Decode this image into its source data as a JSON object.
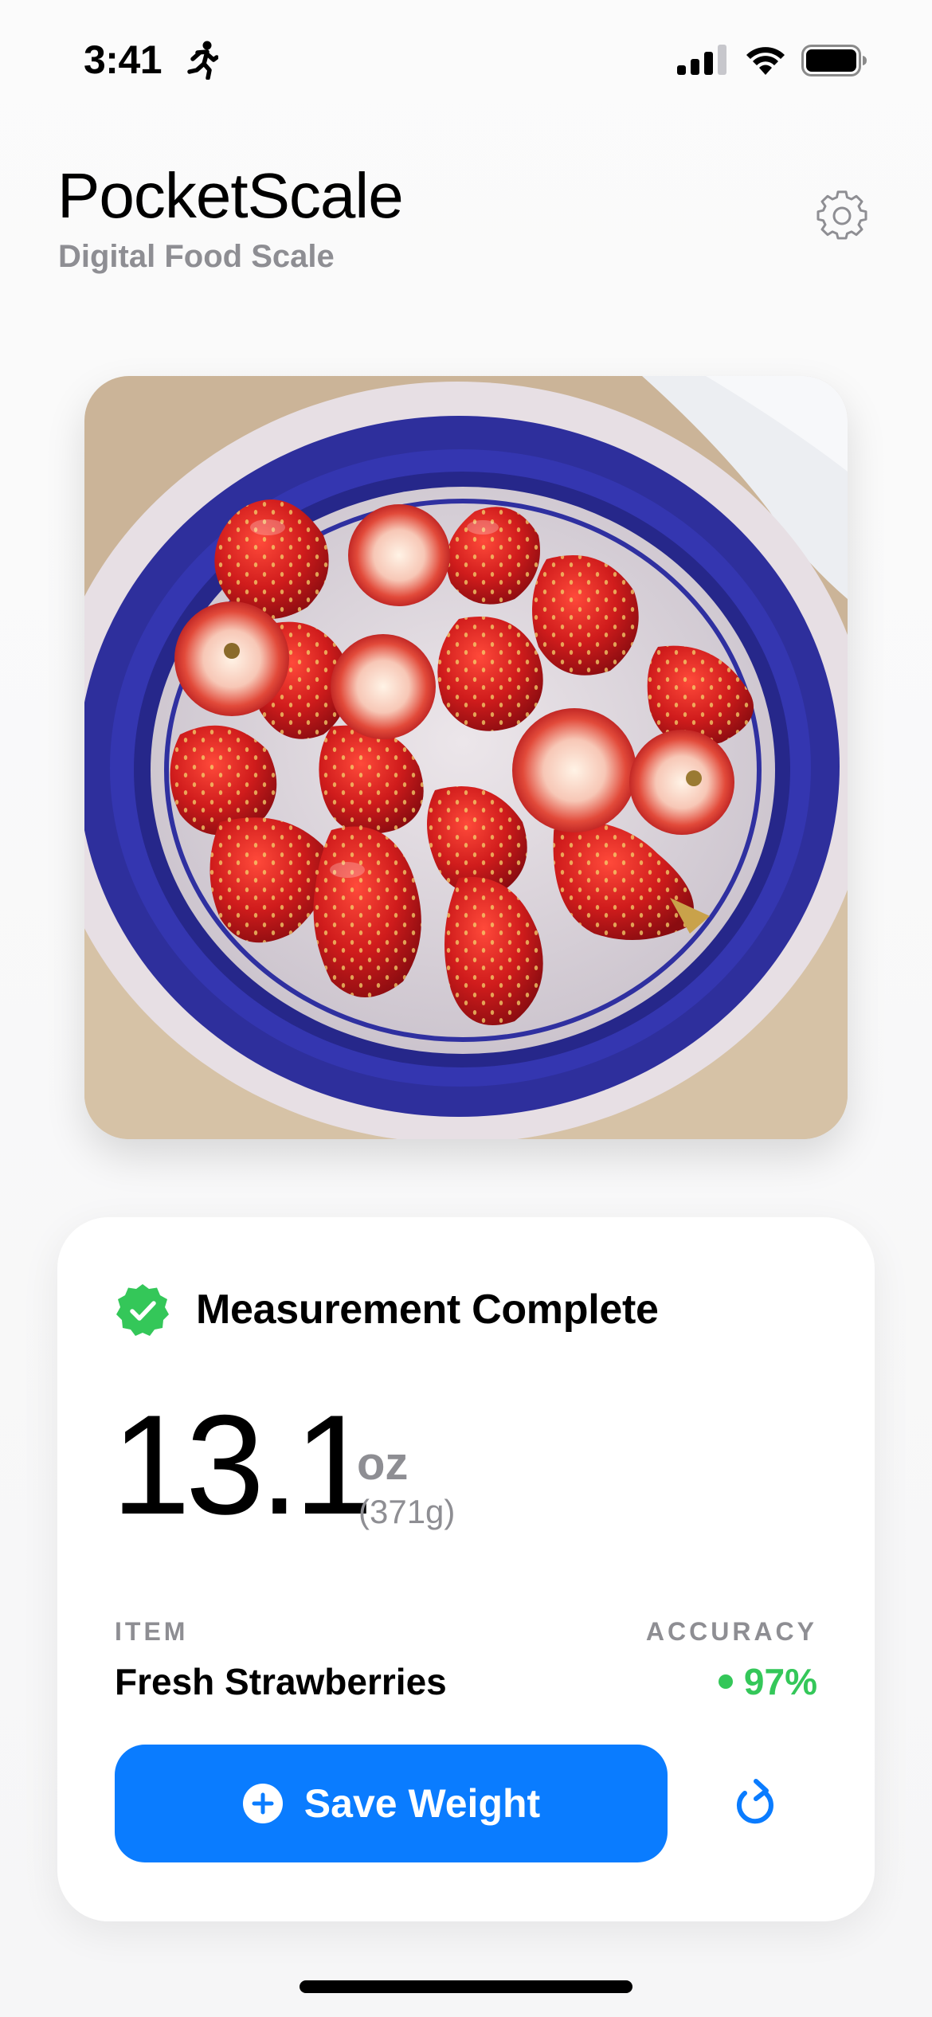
{
  "status_bar": {
    "time": "3:41",
    "activity_icon": "running-figure-icon",
    "signal_icon": "cellular-signal-icon",
    "wifi_icon": "wifi-icon",
    "battery_icon": "battery-full-icon"
  },
  "header": {
    "title": "PocketScale",
    "subtitle": "Digital Food Scale",
    "settings_icon": "gear-icon"
  },
  "photo": {
    "subject": "bowl-of-strawberries"
  },
  "result": {
    "status_icon": "verified-check-badge-icon",
    "status_text": "Measurement Complete",
    "weight_value": "13.1",
    "weight_unit": "oz",
    "weight_grams": "(371g)",
    "item_label": "ITEM",
    "item_value": "Fresh Strawberries",
    "accuracy_label": "ACCURACY",
    "accuracy_value": "97%",
    "save_button_label": "Save Weight",
    "save_icon": "plus-circle-icon",
    "refresh_icon": "refresh-icon"
  },
  "colors": {
    "accent": "#0a7cff",
    "success": "#34c759",
    "secondary_text": "#8e8e93",
    "bowl_blue": "#2e2f9c",
    "strawberry_red": "#c8181a"
  }
}
